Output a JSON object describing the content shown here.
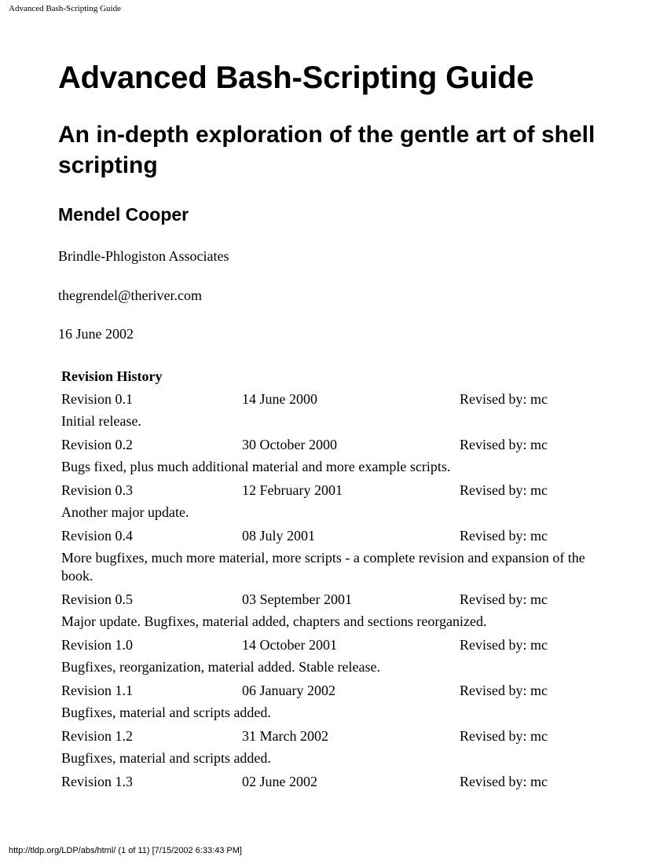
{
  "page": {
    "running_header": "Advanced Bash-Scripting Guide",
    "running_footer": "http://tldp.org/LDP/abs/html/ (1 of 11) [7/15/2002 6:33:43 PM]"
  },
  "document": {
    "title": "Advanced Bash-Scripting Guide",
    "subtitle": "An in-depth exploration of the gentle art of shell scripting",
    "author": "Mendel Cooper",
    "affiliation": "Brindle-Phlogiston Associates",
    "email": "thegrendel@theriver.com",
    "pubdate": "16 June 2002"
  },
  "revision_history": {
    "heading": "Revision History",
    "revisions": [
      {
        "number": "Revision 0.1",
        "date": "14 June 2000",
        "revised_by": "Revised by: mc",
        "note": "Initial release."
      },
      {
        "number": "Revision 0.2",
        "date": "30 October 2000",
        "revised_by": "Revised by: mc",
        "note": "Bugs fixed, plus much additional material and more example scripts."
      },
      {
        "number": "Revision 0.3",
        "date": "12 February 2001",
        "revised_by": "Revised by: mc",
        "note": "Another major update."
      },
      {
        "number": "Revision 0.4",
        "date": "08 July 2001",
        "revised_by": "Revised by: mc",
        "note": "More bugfixes, much more material, more scripts - a complete revision and expansion of the book."
      },
      {
        "number": "Revision 0.5",
        "date": "03 September 2001",
        "revised_by": "Revised by: mc",
        "note": "Major update. Bugfixes, material added, chapters and sections reorganized."
      },
      {
        "number": "Revision 1.0",
        "date": "14 October 2001",
        "revised_by": "Revised by: mc",
        "note": "Bugfixes, reorganization, material added. Stable release."
      },
      {
        "number": "Revision 1.1",
        "date": "06 January 2002",
        "revised_by": "Revised by: mc",
        "note": "Bugfixes, material and scripts added."
      },
      {
        "number": "Revision 1.2",
        "date": "31 March 2002",
        "revised_by": "Revised by: mc",
        "note": "Bugfixes, material and scripts added."
      },
      {
        "number": "Revision 1.3",
        "date": "02 June 2002",
        "revised_by": "Revised by: mc",
        "note": null
      }
    ]
  }
}
